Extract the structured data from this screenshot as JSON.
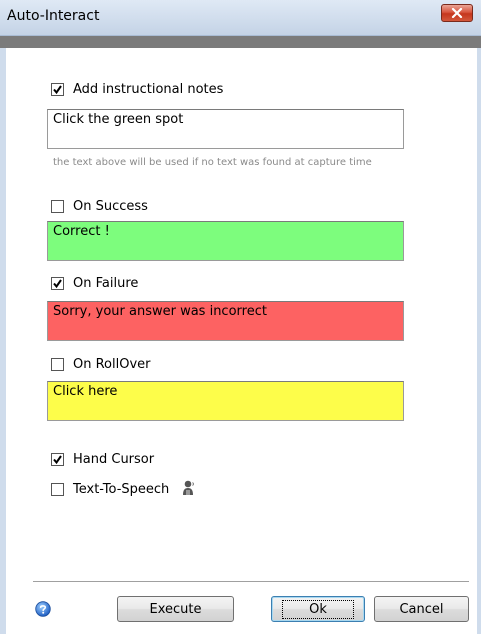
{
  "window": {
    "title": "Auto-Interact"
  },
  "icons": {
    "close": "close-icon",
    "check": "checkmark-icon",
    "speech": "person-speaker-icon",
    "help": "help-icon"
  },
  "colors": {
    "success_bg": "#7dfd7d",
    "failure_bg": "#fd6262",
    "rollover_bg": "#fdfd4a",
    "close_button": "#d3573b"
  },
  "instructional": {
    "label": "Add instructional notes",
    "checked": true,
    "text": "Click the green spot",
    "hint": "the text above will be used if no text was found at capture time"
  },
  "success": {
    "label": "On Success",
    "checked": false,
    "text": "Correct !"
  },
  "failure": {
    "label": "On Failure",
    "checked": true,
    "text": "Sorry, your answer was incorrect"
  },
  "rollover": {
    "label": "On RollOver",
    "checked": false,
    "text": "Click here"
  },
  "hand_cursor": {
    "label": "Hand Cursor",
    "checked": true
  },
  "tts": {
    "label": "Text-To-Speech",
    "checked": false
  },
  "buttons": {
    "execute": "Execute",
    "ok": "Ok",
    "cancel": "Cancel"
  }
}
